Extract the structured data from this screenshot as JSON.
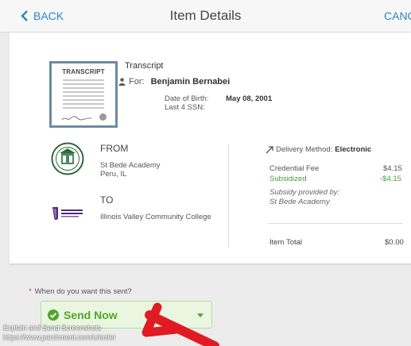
{
  "header": {
    "back_label": "BACK",
    "title": "Item Details",
    "cancel_label": "CANC"
  },
  "item": {
    "thumbnail_label": "TRANSCRIPT",
    "document_name": "Transcript",
    "for_label": "For:",
    "student_name": "Benjamin Bernabei",
    "dob_label": "Date of Birth:",
    "dob_value": "May 08, 2001",
    "ssn_label": "Last 4 SSN:"
  },
  "from": {
    "heading": "FROM",
    "school": "St Bede Academy",
    "location": "Peru, IL"
  },
  "to": {
    "heading": "TO",
    "school": "Illinois Valley Community College"
  },
  "pricing": {
    "delivery_label": "Delivery Method:",
    "delivery_value": "Electronic",
    "fee_label": "Credential Fee",
    "fee_value": "$4.15",
    "subsidized_label": "Subsidized",
    "subsidized_value": "-$4.15",
    "subsidy_by_label": "Subsidy provided by:",
    "subsidy_by_school": "St Bede Academy",
    "total_label": "Item Total",
    "total_value": "$0.00"
  },
  "send": {
    "question": "When do you want this sent?",
    "required_mark": "*",
    "selected_option": "Send Now"
  },
  "overlay": {
    "line1": "Explain and Send Screenshots",
    "line2": "https://www.parchment.com/u/order"
  },
  "colors": {
    "link": "#2b86c6",
    "success": "#3ea33e",
    "annotation_arrow": "#e01b24"
  }
}
